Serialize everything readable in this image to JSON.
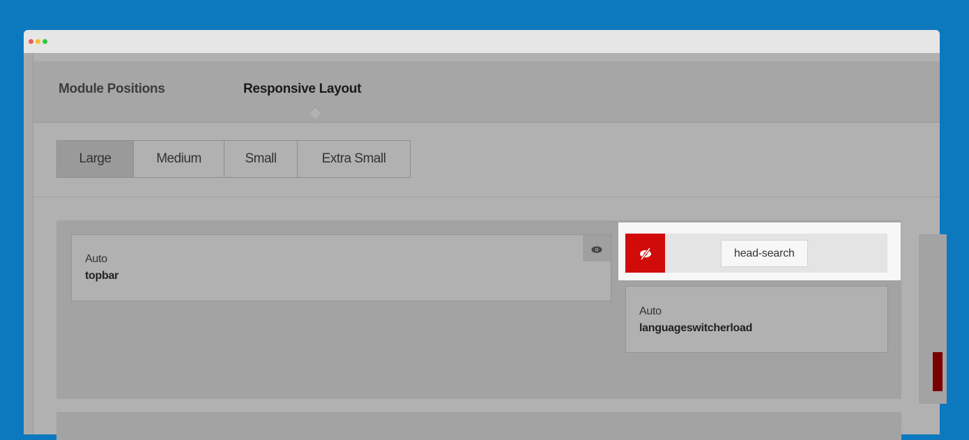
{
  "tabs": [
    {
      "label": "Module Positions"
    },
    {
      "label": "Responsive Layout"
    }
  ],
  "breakpoints": [
    {
      "label": "Large"
    },
    {
      "label": "Medium"
    },
    {
      "label": "Small"
    },
    {
      "label": "Extra Small"
    }
  ],
  "modules": [
    {
      "width": "Auto",
      "name": "topbar"
    },
    {
      "width": "Auto",
      "name": "languageswitcherload"
    }
  ],
  "highlighted_module": {
    "name": "head-search",
    "visibility": "hidden"
  },
  "icons": {
    "visible": "eye-icon",
    "hidden": "eye-slash-icon"
  },
  "colors": {
    "accent_red": "#d10a0a",
    "background_blue": "#0c78be"
  }
}
